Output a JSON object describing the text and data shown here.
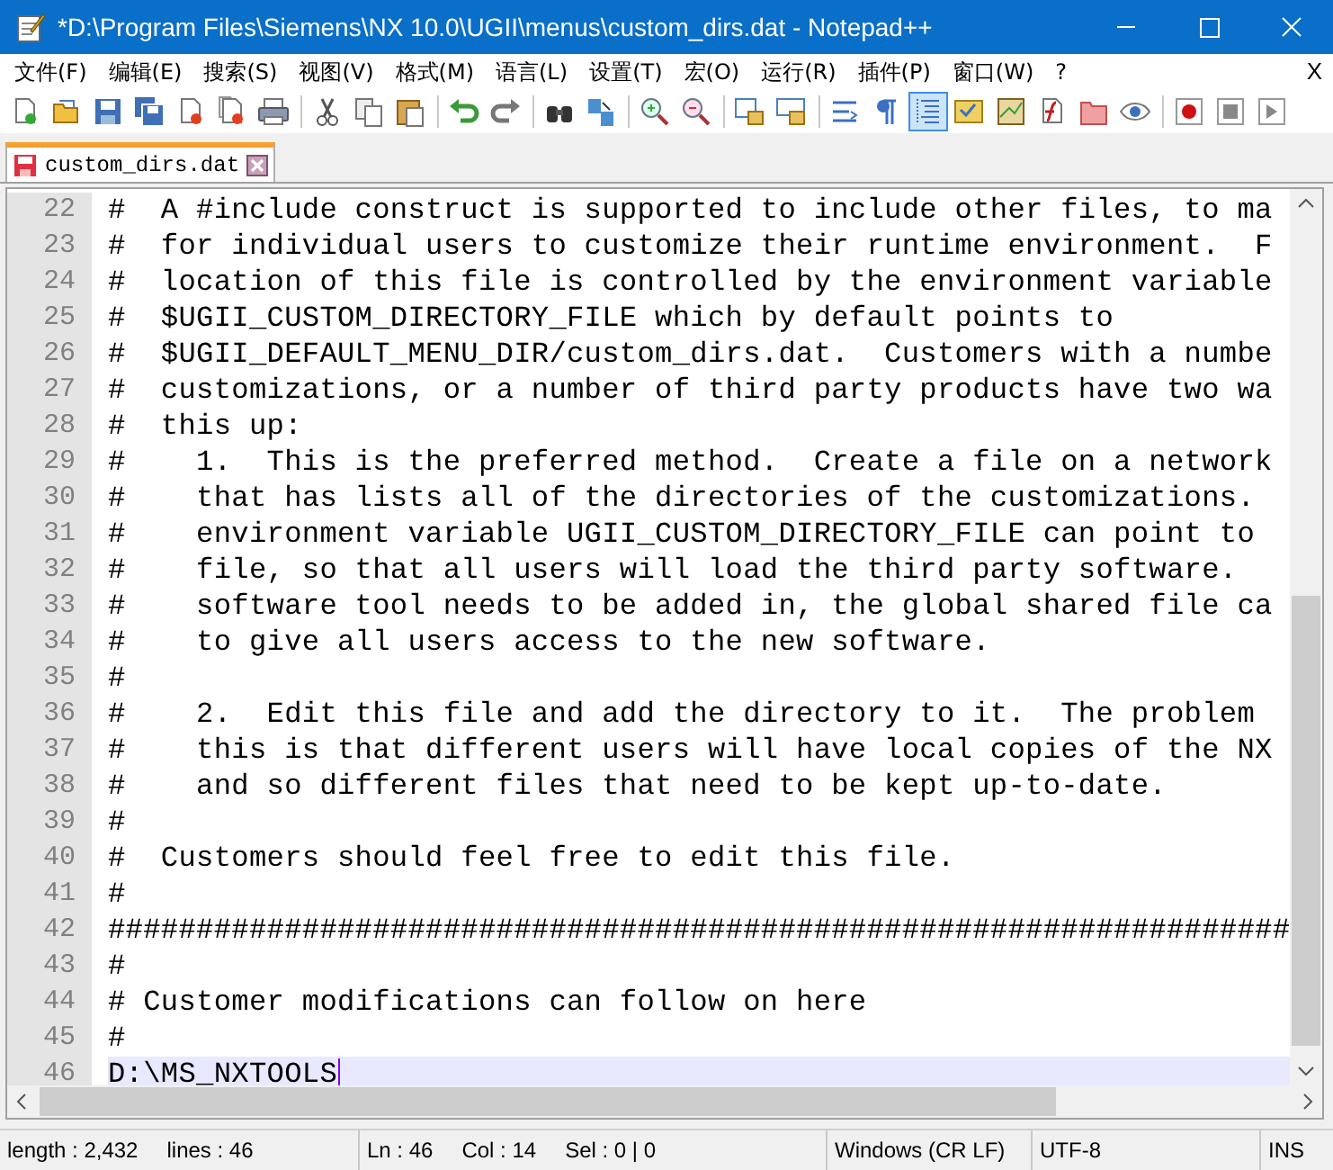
{
  "window": {
    "title": "*D:\\Program Files\\Siemens\\NX 10.0\\UGII\\menus\\custom_dirs.dat - Notepad++"
  },
  "menu": [
    "文件(F)",
    "编辑(E)",
    "搜索(S)",
    "视图(V)",
    "格式(M)",
    "语言(L)",
    "设置(T)",
    "宏(O)",
    "运行(R)",
    "插件(P)",
    "窗口(W)",
    "?"
  ],
  "menu_close": "X",
  "toolbar_buttons": [
    {
      "on": false
    },
    {
      "on": false
    },
    {
      "on": false
    },
    {
      "on": false
    },
    {
      "on": false
    },
    {
      "on": false
    },
    {
      "on": false
    },
    {
      "on": false
    },
    {
      "on": false
    },
    {
      "on": false
    },
    {
      "on": false
    },
    {
      "on": false
    },
    {
      "on": false
    },
    {
      "on": false
    },
    {
      "on": false
    },
    {
      "on": false
    },
    {
      "on": false
    },
    {
      "on": false
    },
    {
      "on": false
    },
    {
      "on": false
    },
    {
      "on": true
    },
    {
      "on": false
    },
    {
      "on": false
    },
    {
      "on": false
    },
    {
      "on": false
    },
    {
      "on": false
    },
    {
      "on": false
    },
    {
      "on": false
    },
    {
      "on": false
    }
  ],
  "tabs": [
    {
      "label": "custom_dirs.dat",
      "selected": true,
      "modified": true
    }
  ],
  "lines": [
    {
      "number": "22",
      "text": "#  A #include construct is supported to include other files, to ma",
      "current": false
    },
    {
      "number": "23",
      "text": "#  for individual users to customize their runtime environment.  F",
      "current": false
    },
    {
      "number": "24",
      "text": "#  location of this file is controlled by the environment variable",
      "current": false
    },
    {
      "number": "25",
      "text": "#  $UGII_CUSTOM_DIRECTORY_FILE which by default points to",
      "current": false
    },
    {
      "number": "26",
      "text": "#  $UGII_DEFAULT_MENU_DIR/custom_dirs.dat.  Customers with a numbe",
      "current": false
    },
    {
      "number": "27",
      "text": "#  customizations, or a number of third party products have two wa",
      "current": false
    },
    {
      "number": "28",
      "text": "#  this up:",
      "current": false
    },
    {
      "number": "29",
      "text": "#    1.  This is the preferred method.  Create a file on a network",
      "current": false
    },
    {
      "number": "30",
      "text": "#    that has lists all of the directories of the customizations.",
      "current": false
    },
    {
      "number": "31",
      "text": "#    environment variable UGII_CUSTOM_DIRECTORY_FILE can point to",
      "current": false
    },
    {
      "number": "32",
      "text": "#    file, so that all users will load the third party software.",
      "current": false
    },
    {
      "number": "33",
      "text": "#    software tool needs to be added in, the global shared file ca",
      "current": false
    },
    {
      "number": "34",
      "text": "#    to give all users access to the new software.",
      "current": false
    },
    {
      "number": "35",
      "text": "#",
      "current": false
    },
    {
      "number": "36",
      "text": "#    2.  Edit this file and add the directory to it.  The problem",
      "current": false
    },
    {
      "number": "37",
      "text": "#    this is that different users will have local copies of the NX",
      "current": false
    },
    {
      "number": "38",
      "text": "#    and so different files that need to be kept up-to-date.",
      "current": false
    },
    {
      "number": "39",
      "text": "#",
      "current": false
    },
    {
      "number": "40",
      "text": "#  Customers should feel free to edit this file.",
      "current": false
    },
    {
      "number": "41",
      "text": "#",
      "current": false
    },
    {
      "number": "42",
      "text": "###################################################################",
      "current": false
    },
    {
      "number": "43",
      "text": "#",
      "current": false
    },
    {
      "number": "44",
      "text": "# Customer modifications can follow on here",
      "current": false
    },
    {
      "number": "45",
      "text": "#",
      "current": false
    },
    {
      "number": "46",
      "text": "D:\\MS_NXTOOLS",
      "current": true
    }
  ],
  "status_bar": {
    "length": "length : 2,432",
    "lines": "lines : 46",
    "ln": "Ln : 46",
    "col": "Col : 14",
    "sel": "Sel : 0 | 0",
    "eol": "Windows (CR LF)",
    "encoding": "UTF-8",
    "mode": "INS"
  }
}
